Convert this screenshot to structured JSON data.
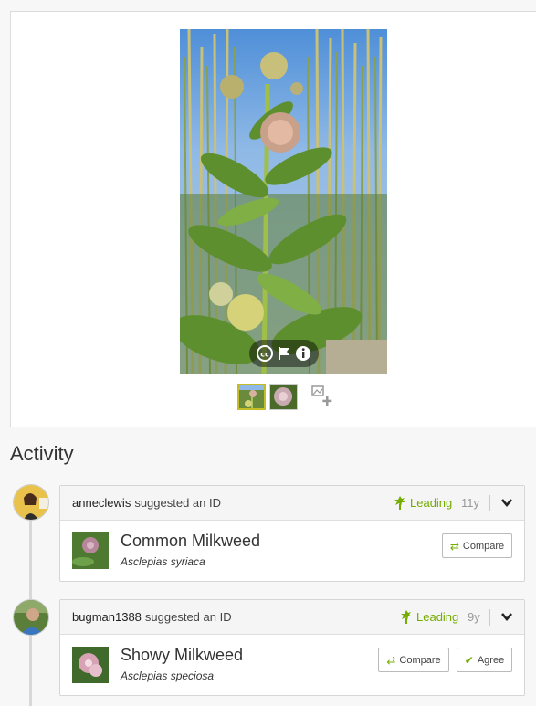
{
  "photo": {
    "controls": [
      "cc-license-icon",
      "flag-icon",
      "info-icon"
    ],
    "thumbnails": [
      "thumbnail-1",
      "thumbnail-2"
    ]
  },
  "activity": {
    "title": "Activity",
    "items": [
      {
        "user": "anneclewis",
        "action": "suggested an ID",
        "status": "Leading",
        "age": "11y",
        "common_name": "Common Milkweed",
        "scientific_name": "Asclepias syriaca",
        "compare_label": "Compare"
      },
      {
        "user": "bugman1388",
        "action": "suggested an ID",
        "status": "Leading",
        "age": "9y",
        "common_name": "Showy Milkweed",
        "scientific_name": "Asclepias speciosa",
        "compare_label": "Compare",
        "agree_label": "Agree"
      }
    ]
  },
  "colors": {
    "accent": "#74ac00",
    "thumb_border": "#c5bd28"
  }
}
